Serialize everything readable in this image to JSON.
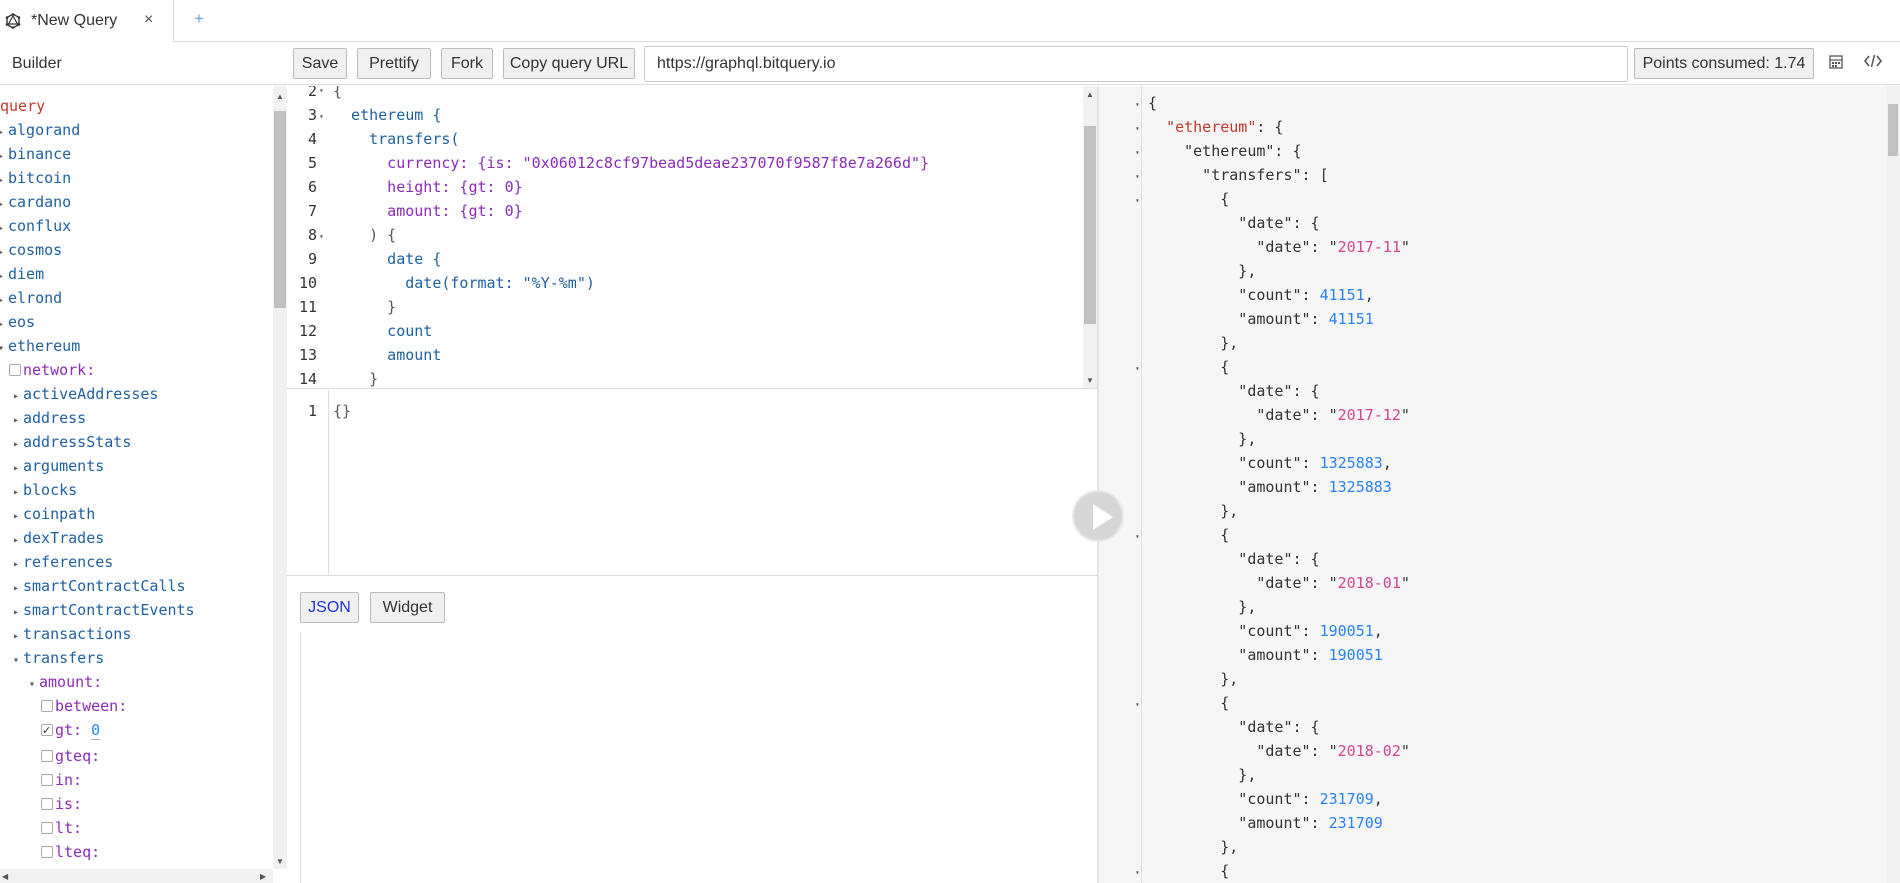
{
  "tab": {
    "title": "*New Query",
    "close_glyph": "×",
    "add_glyph": "+",
    "logo_icon": "graphiql-logo-icon"
  },
  "toolbar": {
    "builder_label": "Builder",
    "save_label": "Save",
    "prettify_label": "Prettify",
    "fork_label": "Fork",
    "copy_url_label": "Copy query URL",
    "url_value": "https://graphql.bitquery.io",
    "points_label": "Points consumed: 1.74",
    "icon1": "calculator-icon",
    "icon2": "code-icon"
  },
  "explorer": {
    "query_label": "query",
    "roots": [
      "algorand",
      "binance",
      "bitcoin",
      "cardano",
      "conflux",
      "cosmos",
      "diem",
      "elrond",
      "eos",
      "ethereum"
    ],
    "ethereum_network_arg": "network:",
    "ethereum_fields": [
      "activeAddresses",
      "address",
      "addressStats",
      "arguments",
      "blocks",
      "coinpath",
      "dexTrades",
      "references",
      "smartContractCalls",
      "smartContractEvents",
      "transactions",
      "transfers"
    ],
    "amount_arg": "amount:",
    "amount_subargs": [
      {
        "label": "between:",
        "checked": false,
        "value": ""
      },
      {
        "label": "gt:",
        "checked": true,
        "value": "0"
      },
      {
        "label": "gteq:",
        "checked": false,
        "value": ""
      },
      {
        "label": "in:",
        "checked": false,
        "value": ""
      },
      {
        "label": "is:",
        "checked": false,
        "value": ""
      },
      {
        "label": "lt:",
        "checked": false,
        "value": ""
      },
      {
        "label": "lteq:",
        "checked": false,
        "value": ""
      }
    ]
  },
  "editor": {
    "lines": [
      {
        "n": "2",
        "fold": "▾",
        "text": "{"
      },
      {
        "n": "3",
        "fold": "▾",
        "text": "  ethereum {"
      },
      {
        "n": "4",
        "fold": "",
        "text": "    transfers("
      },
      {
        "n": "5",
        "fold": "",
        "text": "      currency: {is: \"0x06012c8cf97bead5deae237070f9587f8e7a266d\"}"
      },
      {
        "n": "6",
        "fold": "",
        "text": "      height: {gt: 0}"
      },
      {
        "n": "7",
        "fold": "",
        "text": "      amount: {gt: 0}"
      },
      {
        "n": "8",
        "fold": "▾",
        "text": "    ) {"
      },
      {
        "n": "9",
        "fold": "",
        "text": "      date {"
      },
      {
        "n": "10",
        "fold": "",
        "text": "        date(format: \"%Y-%m\")"
      },
      {
        "n": "11",
        "fold": "",
        "text": "      }"
      },
      {
        "n": "12",
        "fold": "",
        "text": "      count"
      },
      {
        "n": "13",
        "fold": "",
        "text": "      amount"
      },
      {
        "n": "14",
        "fold": "",
        "text": "    }"
      }
    ]
  },
  "variables": {
    "line_number": "1",
    "text": "{}"
  },
  "result_mode": {
    "json_label": "JSON",
    "widget_label": "Widget"
  },
  "result": {
    "entries": [
      {
        "date": "2017-11",
        "count": "41151",
        "amount": "41151"
      },
      {
        "date": "2017-12",
        "count": "1325883",
        "amount": "1325883"
      },
      {
        "date": "2018-01",
        "count": "190051",
        "amount": "190051"
      },
      {
        "date": "2018-02",
        "count": "231709",
        "amount": "231709"
      }
    ]
  }
}
